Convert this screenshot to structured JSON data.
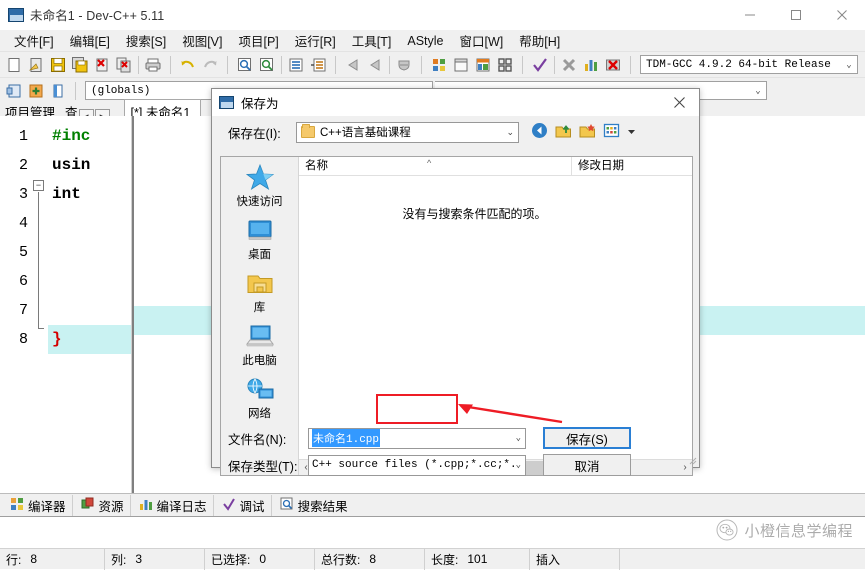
{
  "window": {
    "title": "未命名1 - Dev-C++ 5.11",
    "icon": "devcpp-icon",
    "controls": {
      "minimize": "–",
      "maximize": "□",
      "close": "✕"
    }
  },
  "menubar": {
    "items": [
      {
        "label": "文件[F]",
        "name": "menu-file"
      },
      {
        "label": "编辑[E]",
        "name": "menu-edit"
      },
      {
        "label": "搜索[S]",
        "name": "menu-search"
      },
      {
        "label": "视图[V]",
        "name": "menu-view"
      },
      {
        "label": "项目[P]",
        "name": "menu-project"
      },
      {
        "label": "运行[R]",
        "name": "menu-run"
      },
      {
        "label": "工具[T]",
        "name": "menu-tools"
      },
      {
        "label": "AStyle",
        "name": "menu-astyle"
      },
      {
        "label": "窗口[W]",
        "name": "menu-window"
      },
      {
        "label": "帮助[H]",
        "name": "menu-help"
      }
    ]
  },
  "toolbar": {
    "compiler_combo": {
      "value": "TDM-GCC 4.9.2 64-bit Release",
      "arrow": "⌄"
    },
    "globals_combo": {
      "value": "(globals)",
      "arrow": "⌄"
    }
  },
  "tabs": {
    "project_panel": "项目管理",
    "view_panel": "查",
    "nav_prev": "◄",
    "nav_next": "►",
    "editor_tab": "[*] 未命名1"
  },
  "editor": {
    "line_numbers": [
      "1",
      "2",
      "3",
      "4",
      "5",
      "6",
      "7",
      "8"
    ],
    "lines": [
      {
        "text": "#inc",
        "color": "green"
      },
      {
        "text": "usin",
        "color": "black"
      },
      {
        "text": "int",
        "color": "black"
      },
      {
        "text": "",
        "color": "black"
      },
      {
        "text": "",
        "color": "black"
      },
      {
        "text": "",
        "color": "black"
      },
      {
        "text": "",
        "color": "black"
      },
      {
        "text": "}",
        "color": "red",
        "highlight": true
      }
    ],
    "fold_marker": "−"
  },
  "bottom_panel": {
    "tabs": [
      {
        "label": "编译器",
        "icon": "compiler-icon"
      },
      {
        "label": "资源",
        "icon": "resource-icon"
      },
      {
        "label": "编译日志",
        "icon": "log-icon"
      },
      {
        "label": "调试",
        "icon": "debug-icon"
      },
      {
        "label": "搜索结果",
        "icon": "search-result-icon"
      }
    ]
  },
  "statusbar": {
    "cells": [
      {
        "label": "行:",
        "value": "8"
      },
      {
        "label": "列:",
        "value": "3"
      },
      {
        "label": "已选择:",
        "value": "0"
      },
      {
        "label": "总行数:",
        "value": "8"
      },
      {
        "label": "长度:",
        "value": "101"
      },
      {
        "label": "插入",
        "value": ""
      }
    ]
  },
  "watermark": {
    "text": "小橙信息学编程"
  },
  "dialog": {
    "title": "保存为",
    "close": "✕",
    "save_in_label": "保存在(I):",
    "save_in_value": "C++语言基础课程",
    "combo_arrow": "⌄",
    "toolbar_icons": [
      "back-icon",
      "up-folder-icon",
      "new-folder-icon",
      "view-mode-icon",
      "view-mode-dropdown-icon"
    ],
    "places": [
      {
        "label": "快速访问",
        "icon": "quick-access-star-icon"
      },
      {
        "label": "桌面",
        "icon": "desktop-icon"
      },
      {
        "label": "库",
        "icon": "library-folder-icon"
      },
      {
        "label": "此电脑",
        "icon": "this-pc-icon"
      },
      {
        "label": "网络",
        "icon": "network-icon"
      }
    ],
    "columns": [
      {
        "label": "名称",
        "sort": "^"
      },
      {
        "label": "修改日期",
        "sort": ""
      }
    ],
    "empty_message": "没有与搜索条件匹配的项。",
    "scroll_left": "‹",
    "scroll_right": "›",
    "filename_label": "文件名(N):",
    "filename_value": "未命名1.cpp",
    "filetype_label": "保存类型(T):",
    "filetype_value": "C++ source files (*.cpp;*.cc;*.cxx;*.",
    "save_button": "保存(S)",
    "cancel_button": "取消"
  },
  "annotation": {
    "color": "#ee1c25"
  }
}
